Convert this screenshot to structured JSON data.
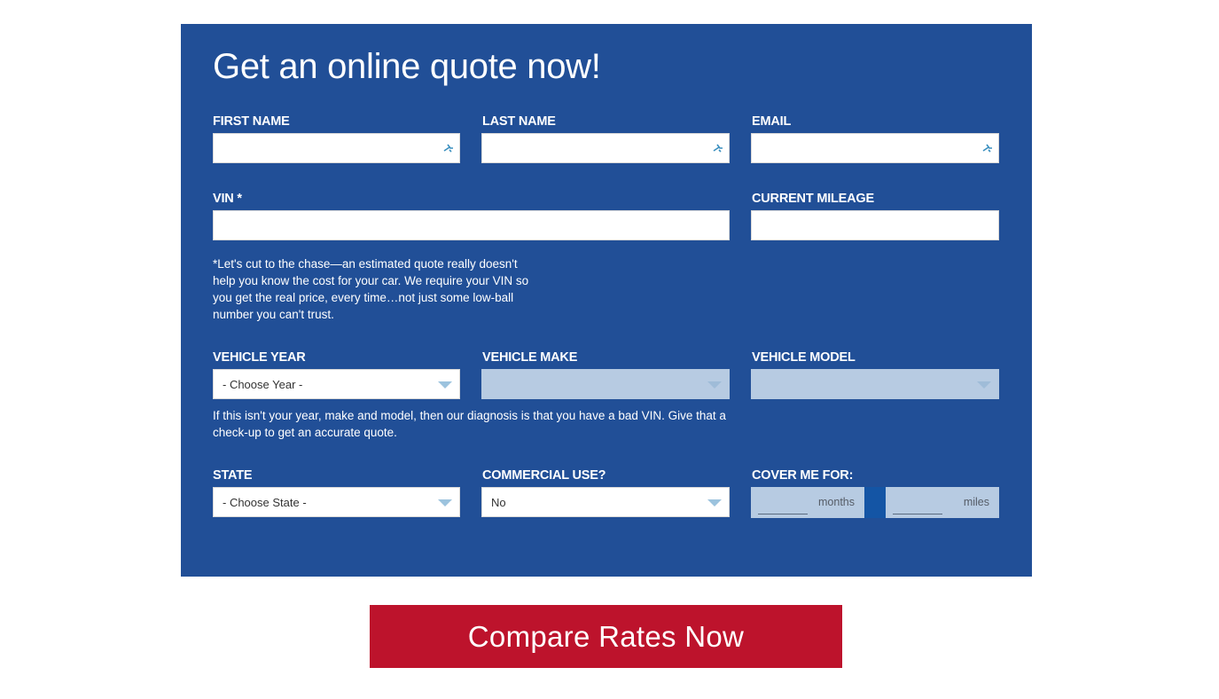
{
  "form": {
    "title": "Get an online quote now!",
    "fields": {
      "first_name_label": "FIRST NAME",
      "last_name_label": "LAST NAME",
      "email_label": "EMAIL",
      "vin_label": "VIN *",
      "mileage_label": "CURRENT MILEAGE",
      "vehicle_year_label": "VEHICLE YEAR",
      "vehicle_make_label": "VEHICLE MAKE",
      "vehicle_model_label": "VEHICLE MODEL",
      "state_label": "STATE",
      "commercial_label": "COMMERCIAL USE?",
      "cover_label": "COVER ME FOR:"
    },
    "vin_note": "*Let's cut to the chase—an estimated quote really doesn't help you know the cost for your car. We require your VIN so you get the real price, every time…not just some low-ball number you can't trust.",
    "vehicle_note": "If this isn't your year, make and model, then our diagnosis is that you have a bad VIN. Give that a check-up to get an accurate quote.",
    "selects": {
      "year_value": "- Choose Year -",
      "make_value": "",
      "model_value": "",
      "state_value": "- Choose State -",
      "commercial_value": "No"
    },
    "cover": {
      "months_unit": "months",
      "miles_unit": "miles"
    }
  },
  "cta": {
    "label": "Compare Rates Now",
    "color": "#bd132c"
  },
  "colors": {
    "panel": "#214f97",
    "disabled_select": "#b7cbe2"
  },
  "icons": {
    "autofill": "autofill-key-icon",
    "dropdown": "chevron-down-icon"
  }
}
